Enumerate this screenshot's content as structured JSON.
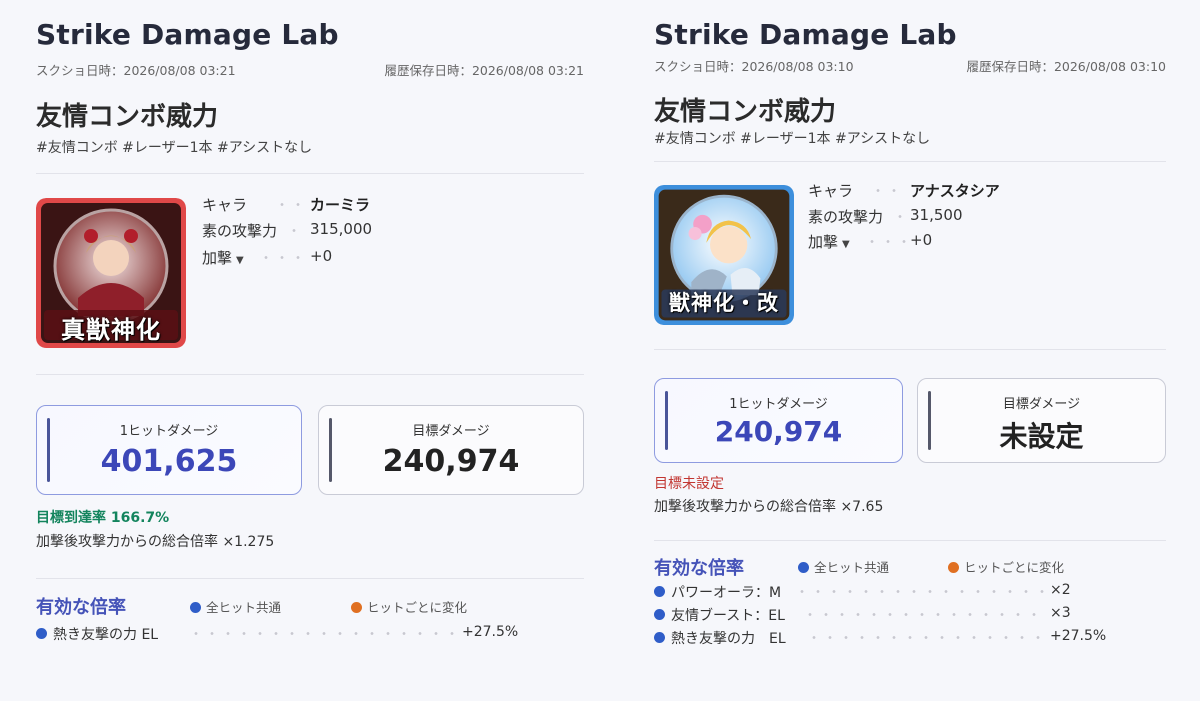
{
  "left": {
    "app_title": "Strike Damage Lab",
    "screenshot_time": "スクショ日時：2026/08/08 03:21",
    "saved_time": "履歴保存日時：2026/08/08 03:21",
    "section_title": "友情コンボ威力",
    "tags": "#友情コンボ #レーザー1本 #アシストなし",
    "icon_banner": "真獣神化",
    "stats": [
      {
        "label": "キャラ",
        "value": "カーミラ"
      },
      {
        "label": "素の攻撃力",
        "value": "315,000"
      },
      {
        "label": "加撃",
        "value": "+0"
      }
    ],
    "caret": "▼",
    "hit_card": {
      "caption": "1ヒットダメージ",
      "value": "401,625"
    },
    "target_card": {
      "caption": "目標ダメージ",
      "value": "240,974"
    },
    "status_label": "目標到達率",
    "status_value": "166.7%",
    "multiplier_total": "加撃後攻撃力からの総合倍率 ×1.275",
    "effects_title": "有効な倍率",
    "legend_common": "全ヒット共通",
    "legend_per_hit": "ヒットごとに変化",
    "effects": [
      {
        "name": "熱き友撃の力 EL",
        "value": "+27.5%",
        "color": "#2f5dc8"
      }
    ]
  },
  "right": {
    "app_title": "Strike Damage Lab",
    "screenshot_time": "スクショ日時：2026/08/08 03:10",
    "saved_time": "履歴保存日時：2026/08/08 03:10",
    "section_title": "友情コンボ威力",
    "tags": "#友情コンボ #レーザー1本 #アシストなし",
    "icon_banner": "獣神化・改",
    "stats": [
      {
        "label": "キャラ",
        "value": "アナスタシア"
      },
      {
        "label": "素の攻撃力",
        "value": "31,500"
      },
      {
        "label": "加撃",
        "value": "+0"
      }
    ],
    "caret": "▼",
    "hit_card": {
      "caption": "1ヒットダメージ",
      "value": "240,974"
    },
    "target_card": {
      "caption": "目標ダメージ",
      "value": "未設定"
    },
    "status_text": "目標未設定",
    "multiplier_total": "加撃後攻撃力からの総合倍率 ×7.65",
    "effects_title": "有効な倍率",
    "legend_common": "全ヒット共通",
    "legend_per_hit": "ヒットごとに変化",
    "effects": [
      {
        "name": "パワーオーラ：M",
        "value": "×2",
        "color": "#2f5dc8"
      },
      {
        "name": "友情ブースト：EL",
        "value": "×3",
        "color": "#2f5dc8"
      },
      {
        "name": "熱き友撃の力　EL",
        "value": "+27.5%",
        "color": "#2f5dc8"
      }
    ]
  },
  "colors": {
    "accent_blue": "#3c47b8",
    "success_green": "#13845d",
    "warning_red": "#c23631",
    "common_dot": "#2f5dc8",
    "per_hit_dot": "#e07022",
    "left_icon_frame": "#e04848",
    "right_icon_frame": "#3d8fdc"
  }
}
